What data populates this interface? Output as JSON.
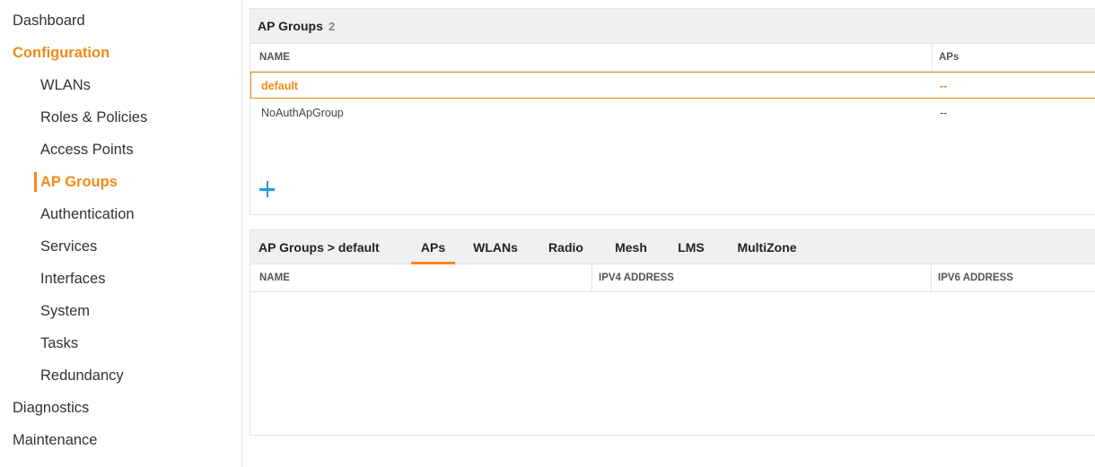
{
  "sidebar": {
    "items": [
      {
        "label": "Dashboard"
      },
      {
        "label": "Configuration"
      },
      {
        "label": "WLANs"
      },
      {
        "label": "Roles & Policies"
      },
      {
        "label": "Access Points"
      },
      {
        "label": "AP Groups"
      },
      {
        "label": "Authentication"
      },
      {
        "label": "Services"
      },
      {
        "label": "Interfaces"
      },
      {
        "label": "System"
      },
      {
        "label": "Tasks"
      },
      {
        "label": "Redundancy"
      },
      {
        "label": "Diagnostics"
      },
      {
        "label": "Maintenance"
      }
    ],
    "active_item": "AP Groups",
    "active_section": "Configuration"
  },
  "ap_groups": {
    "title": "AP Groups",
    "count": "2",
    "columns": [
      "NAME",
      "APs"
    ],
    "rows": [
      {
        "name": "default",
        "aps": "--",
        "selected": true
      },
      {
        "name": "NoAuthApGroup",
        "aps": "--",
        "selected": false
      }
    ]
  },
  "detail": {
    "breadcrumb": "AP Groups > default",
    "tabs": [
      {
        "label": "APs",
        "active": true
      },
      {
        "label": "WLANs"
      },
      {
        "label": "Radio"
      },
      {
        "label": "Mesh"
      },
      {
        "label": "LMS"
      },
      {
        "label": "MultiZone"
      }
    ],
    "columns": [
      "NAME",
      "IPV4 ADDRESS",
      "IPV6 ADDRESS"
    ]
  },
  "colors": {
    "accent": "#f28a17",
    "add_button": "#1f9be0",
    "header_bg": "#eef0f2"
  },
  "icons": {
    "add": "plus-icon"
  }
}
